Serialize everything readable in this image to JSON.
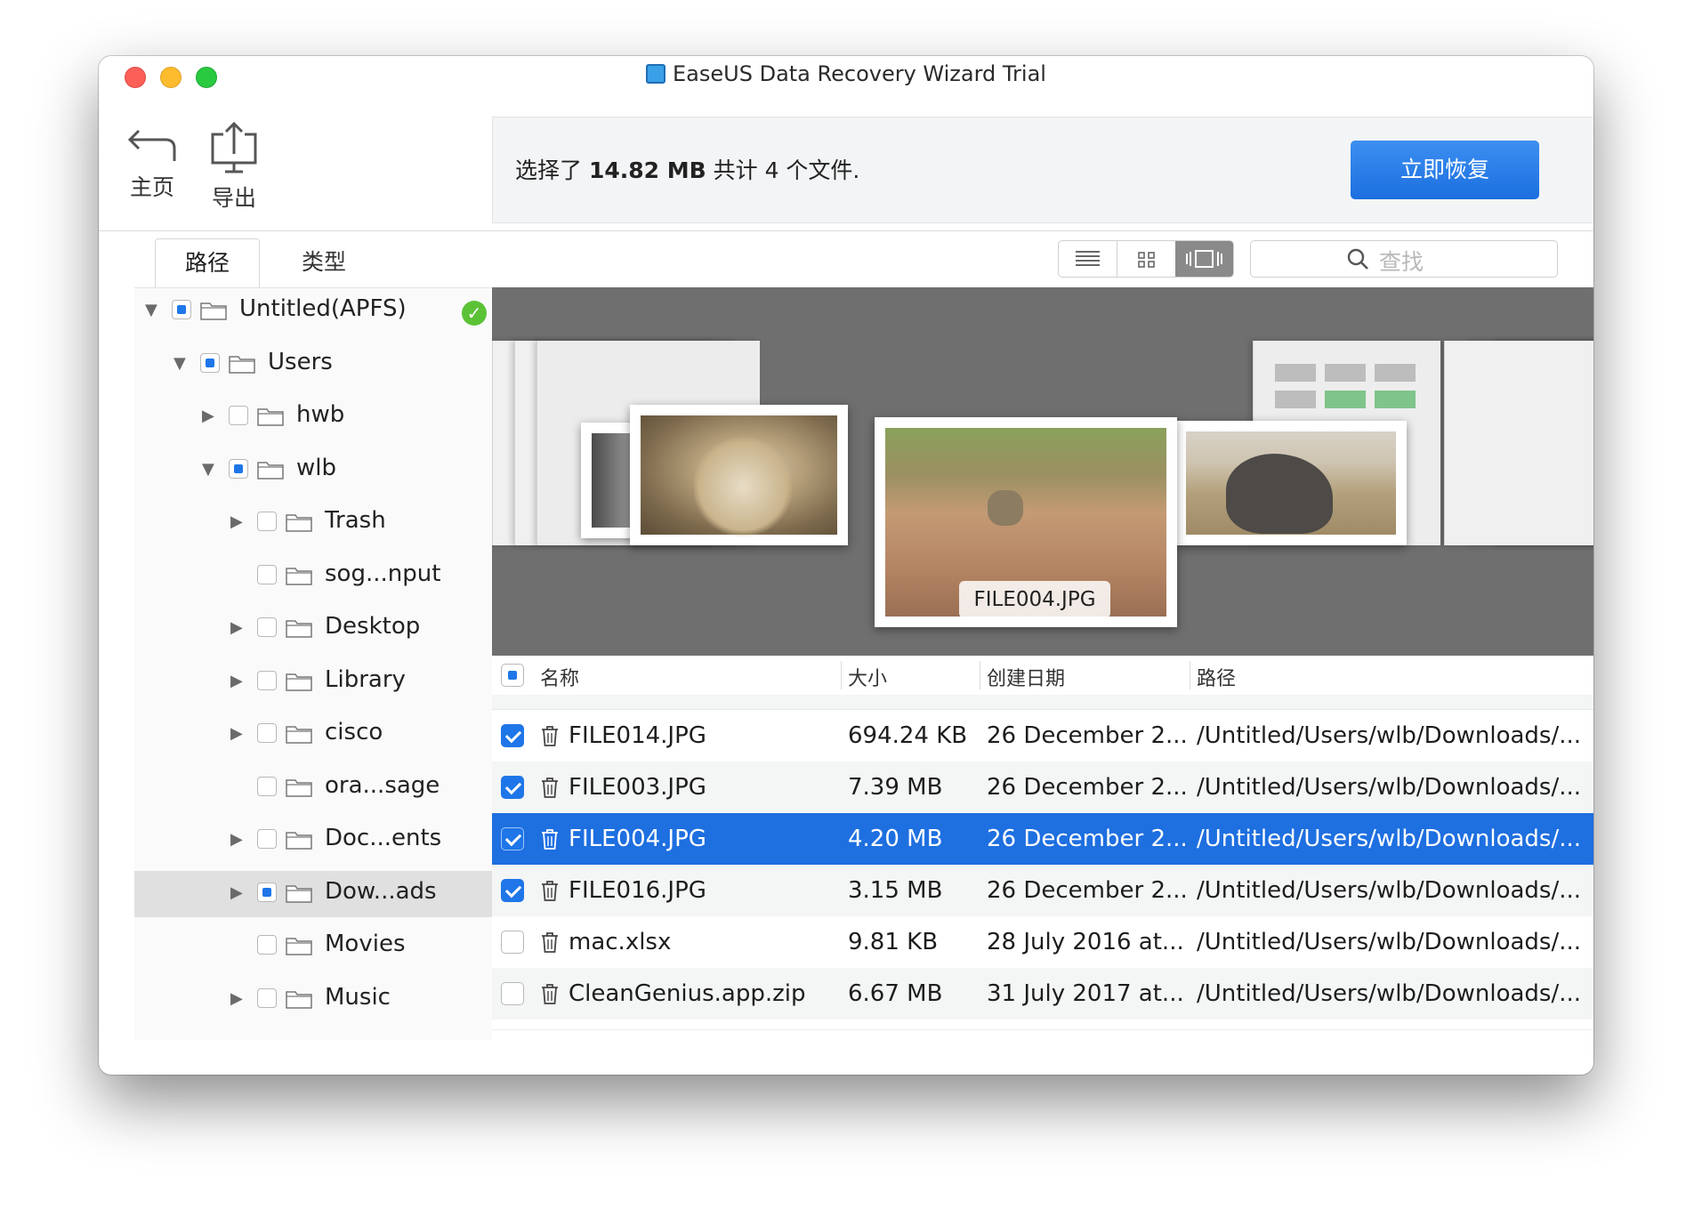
{
  "window": {
    "title": "EaseUS Data Recovery Wizard Trial"
  },
  "toolbar": {
    "home_label": "主页",
    "export_label": "导出"
  },
  "status": {
    "prefix": "选择了 ",
    "size": "14.82 MB",
    "suffix": " 共计 4 个文件.",
    "recover_button": "立即恢复"
  },
  "tabs": {
    "path": "路径",
    "type": "类型"
  },
  "search": {
    "placeholder": "查找"
  },
  "tree": [
    {
      "name": "Untitled(APFS)",
      "level": 0,
      "expanded": true,
      "has_arrow": true,
      "check": "mixed",
      "selected": false,
      "verified": true
    },
    {
      "name": "Users",
      "level": 1,
      "expanded": true,
      "has_arrow": true,
      "check": "mixed",
      "selected": false
    },
    {
      "name": "hwb",
      "level": 2,
      "expanded": false,
      "has_arrow": true,
      "check": "none",
      "selected": false
    },
    {
      "name": "wlb",
      "level": 2,
      "expanded": true,
      "has_arrow": true,
      "check": "mixed",
      "selected": false
    },
    {
      "name": "Trash",
      "level": 3,
      "expanded": false,
      "has_arrow": true,
      "check": "none",
      "selected": false
    },
    {
      "name": "sog...nput",
      "level": 3,
      "expanded": false,
      "has_arrow": false,
      "check": "none",
      "selected": false
    },
    {
      "name": "Desktop",
      "level": 3,
      "expanded": false,
      "has_arrow": true,
      "check": "none",
      "selected": false
    },
    {
      "name": "Library",
      "level": 3,
      "expanded": false,
      "has_arrow": true,
      "check": "none",
      "selected": false
    },
    {
      "name": "cisco",
      "level": 3,
      "expanded": false,
      "has_arrow": true,
      "check": "none",
      "selected": false
    },
    {
      "name": "ora...sage",
      "level": 3,
      "expanded": false,
      "has_arrow": false,
      "check": "none",
      "selected": false
    },
    {
      "name": "Doc...ents",
      "level": 3,
      "expanded": false,
      "has_arrow": true,
      "check": "none",
      "selected": false
    },
    {
      "name": "Dow...ads",
      "level": 3,
      "expanded": false,
      "has_arrow": true,
      "check": "mixed",
      "selected": true
    },
    {
      "name": "Movies",
      "level": 3,
      "expanded": false,
      "has_arrow": false,
      "check": "none",
      "selected": false
    },
    {
      "name": "Music",
      "level": 3,
      "expanded": false,
      "has_arrow": true,
      "check": "none",
      "selected": false
    }
  ],
  "preview": {
    "caption": "FILE004.JPG"
  },
  "table": {
    "columns": [
      "名称",
      "大小",
      "创建日期",
      "路径"
    ],
    "rows": [
      {
        "name": "FILE014.JPG",
        "size": "694.24 KB",
        "date": "26 December 2...",
        "path": "/Untitled/Users/wlb/Downloads/...",
        "checked": true,
        "selected": false
      },
      {
        "name": "FILE003.JPG",
        "size": "7.39 MB",
        "date": "26 December 2...",
        "path": "/Untitled/Users/wlb/Downloads/...",
        "checked": true,
        "selected": false
      },
      {
        "name": "FILE004.JPG",
        "size": "4.20 MB",
        "date": "26 December 2...",
        "path": "/Untitled/Users/wlb/Downloads/...",
        "checked": true,
        "selected": true
      },
      {
        "name": "FILE016.JPG",
        "size": "3.15 MB",
        "date": "26 December 2...",
        "path": "/Untitled/Users/wlb/Downloads/...",
        "checked": true,
        "selected": false
      },
      {
        "name": "mac.xlsx",
        "size": "9.81 KB",
        "date": "28 July 2016 at...",
        "path": "/Untitled/Users/wlb/Downloads/...",
        "checked": false,
        "selected": false
      },
      {
        "name": "CleanGenius.app.zip",
        "size": "6.67 MB",
        "date": "31 July 2017 at...",
        "path": "/Untitled/Users/wlb/Downloads/...",
        "checked": false,
        "selected": false
      }
    ]
  },
  "colors": {
    "accent": "#1e6fe0",
    "verified": "#5bc236",
    "preview_bg": "#6f6f6f"
  }
}
